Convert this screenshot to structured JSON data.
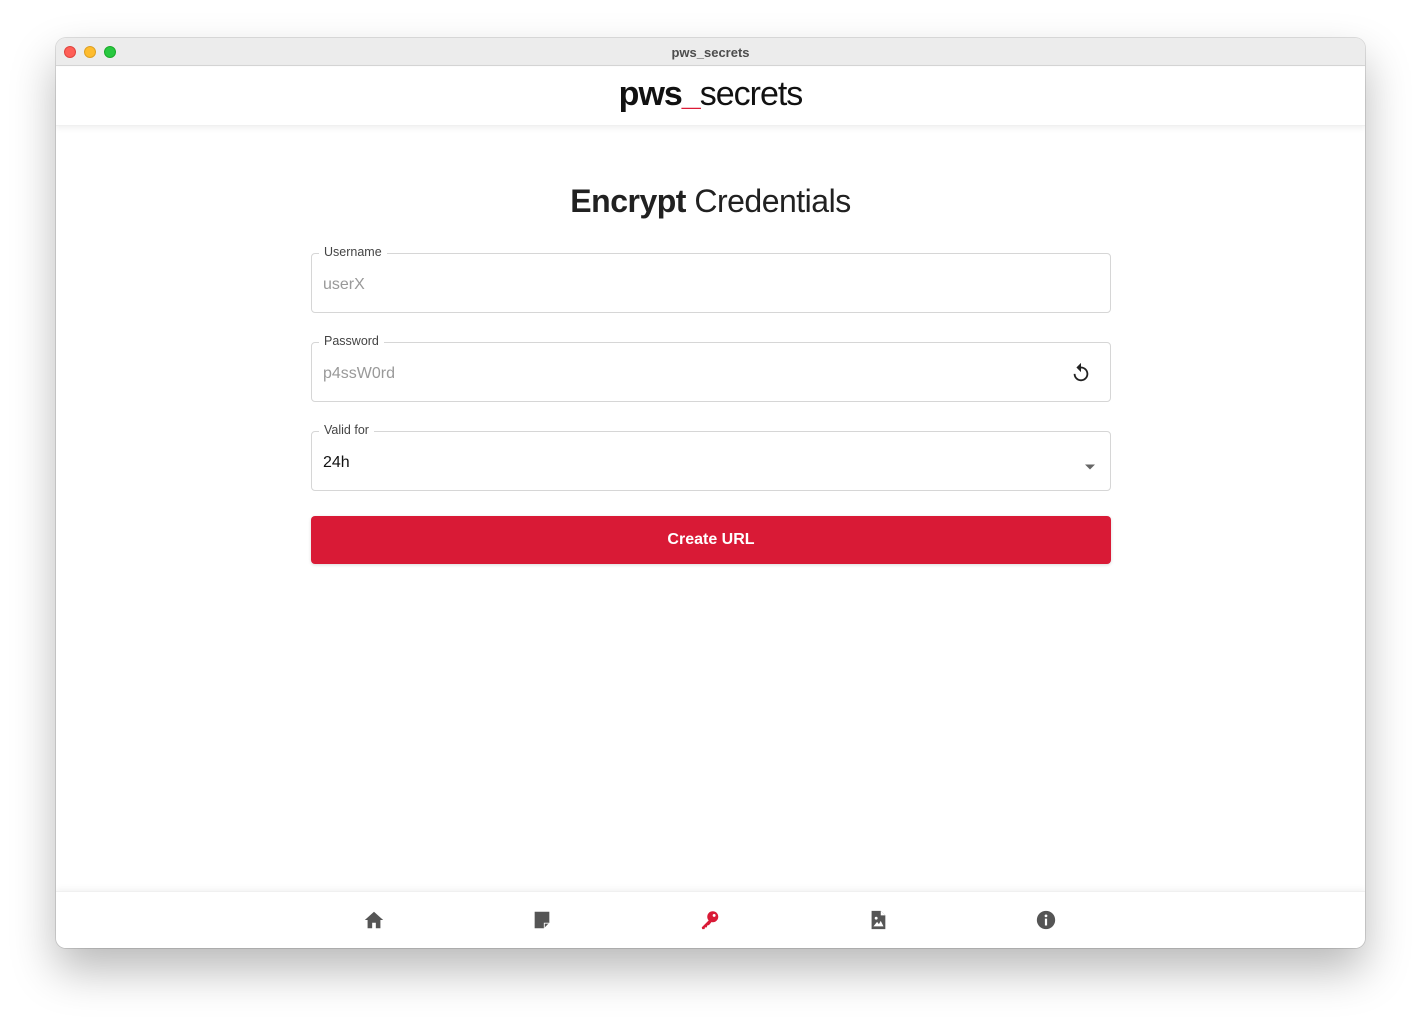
{
  "window": {
    "title": "pws_secrets"
  },
  "header": {
    "logo": {
      "part1": "pws",
      "part2": "_",
      "part3": "secrets"
    }
  },
  "main": {
    "heading_strong": "Encrypt",
    "heading_rest": " Credentials",
    "fields": {
      "username": {
        "label": "Username",
        "placeholder": "userX"
      },
      "password": {
        "label": "Password",
        "placeholder": "p4ssW0rd",
        "action_icon": "refresh-icon"
      },
      "valid_for": {
        "label": "Valid for",
        "value": "24h",
        "icon": "dropdown-arrow-icon"
      }
    },
    "create_button": "Create URL"
  },
  "bottom_nav": {
    "items": [
      {
        "icon": "home-icon",
        "active": false
      },
      {
        "icon": "note-icon",
        "active": false
      },
      {
        "icon": "key-icon",
        "active": true
      },
      {
        "icon": "image-file-icon",
        "active": false
      },
      {
        "icon": "info-icon",
        "active": false
      }
    ]
  },
  "colors": {
    "accent": "#d91a36",
    "icon_default": "#555555",
    "text_primary": "#212121",
    "placeholder": "#999999"
  }
}
